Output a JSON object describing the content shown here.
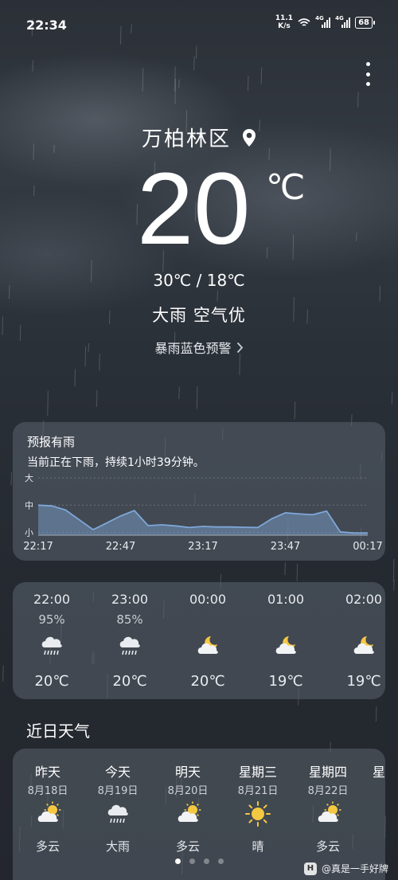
{
  "status_bar": {
    "time": "22:34",
    "net_speed_value": "11.1",
    "net_speed_unit": "K/s",
    "signal_1_label": "4G",
    "signal_2_label": "4G",
    "battery": "68"
  },
  "location": {
    "name": "万柏林区",
    "icon": "location-pin-icon"
  },
  "current": {
    "temperature": "20",
    "unit": "℃",
    "range": "30℃ / 18℃",
    "condition": "大雨  空气优",
    "alert": "暴雨蓝色预警"
  },
  "rain_forecast": {
    "title": "预报有雨",
    "subtitle": "当前正在下雨，持续1小时39分钟。",
    "chart_data": {
      "type": "area",
      "title": "",
      "y_levels": [
        "大",
        "中",
        "小"
      ],
      "x_labels": [
        "22:17",
        "22:47",
        "23:17",
        "23:47",
        "00:17"
      ],
      "x_minutes": [
        0,
        5,
        10,
        15,
        20,
        25,
        30,
        35,
        40,
        45,
        50,
        55,
        60,
        65,
        70,
        75,
        80,
        85,
        90,
        95,
        100,
        105,
        110,
        115,
        120
      ],
      "intensity": [
        2.0,
        1.97,
        1.82,
        1.46,
        1.1,
        1.35,
        1.6,
        1.8,
        1.25,
        1.28,
        1.24,
        1.18,
        1.22,
        1.2,
        1.2,
        1.19,
        1.18,
        1.5,
        1.72,
        1.68,
        1.65,
        1.78,
        1.02,
        0.98,
        0.98
      ],
      "ylim": [
        0.9,
        3.0
      ],
      "color": "#7ea7d8"
    }
  },
  "hourly": [
    {
      "time": "22:00",
      "prob": "95%",
      "icon": "heavy-rain-cloud-icon",
      "temp": "20℃"
    },
    {
      "time": "23:00",
      "prob": "85%",
      "icon": "heavy-rain-cloud-icon",
      "temp": "20℃"
    },
    {
      "time": "00:00",
      "prob": "",
      "icon": "cloudy-night-icon",
      "temp": "20℃"
    },
    {
      "time": "01:00",
      "prob": "",
      "icon": "cloudy-night-icon",
      "temp": "19℃"
    },
    {
      "time": "02:00",
      "prob": "",
      "icon": "cloudy-night-icon",
      "temp": "19℃"
    }
  ],
  "section_title": "近日天气",
  "daily": [
    {
      "name": "昨天",
      "date": "8月18日",
      "icon": "partly-cloudy-icon",
      "desc": "多云"
    },
    {
      "name": "今天",
      "date": "8月19日",
      "icon": "heavy-rain-cloud-icon",
      "desc": "大雨"
    },
    {
      "name": "明天",
      "date": "8月20日",
      "icon": "partly-cloudy-icon",
      "desc": "多云"
    },
    {
      "name": "星期三",
      "date": "8月21日",
      "icon": "sunny-icon",
      "desc": "晴"
    },
    {
      "name": "星期四",
      "date": "8月22日",
      "icon": "partly-cloudy-icon",
      "desc": "多云"
    },
    {
      "name": "星",
      "date": "",
      "icon": "",
      "desc": ""
    }
  ],
  "pager": {
    "count": 4,
    "active": 0
  },
  "watermark": "@真是一手好牌",
  "colors": {
    "card": "#5a626e",
    "chart_fill": "#7ea7d8",
    "sun": "#f5c842"
  }
}
